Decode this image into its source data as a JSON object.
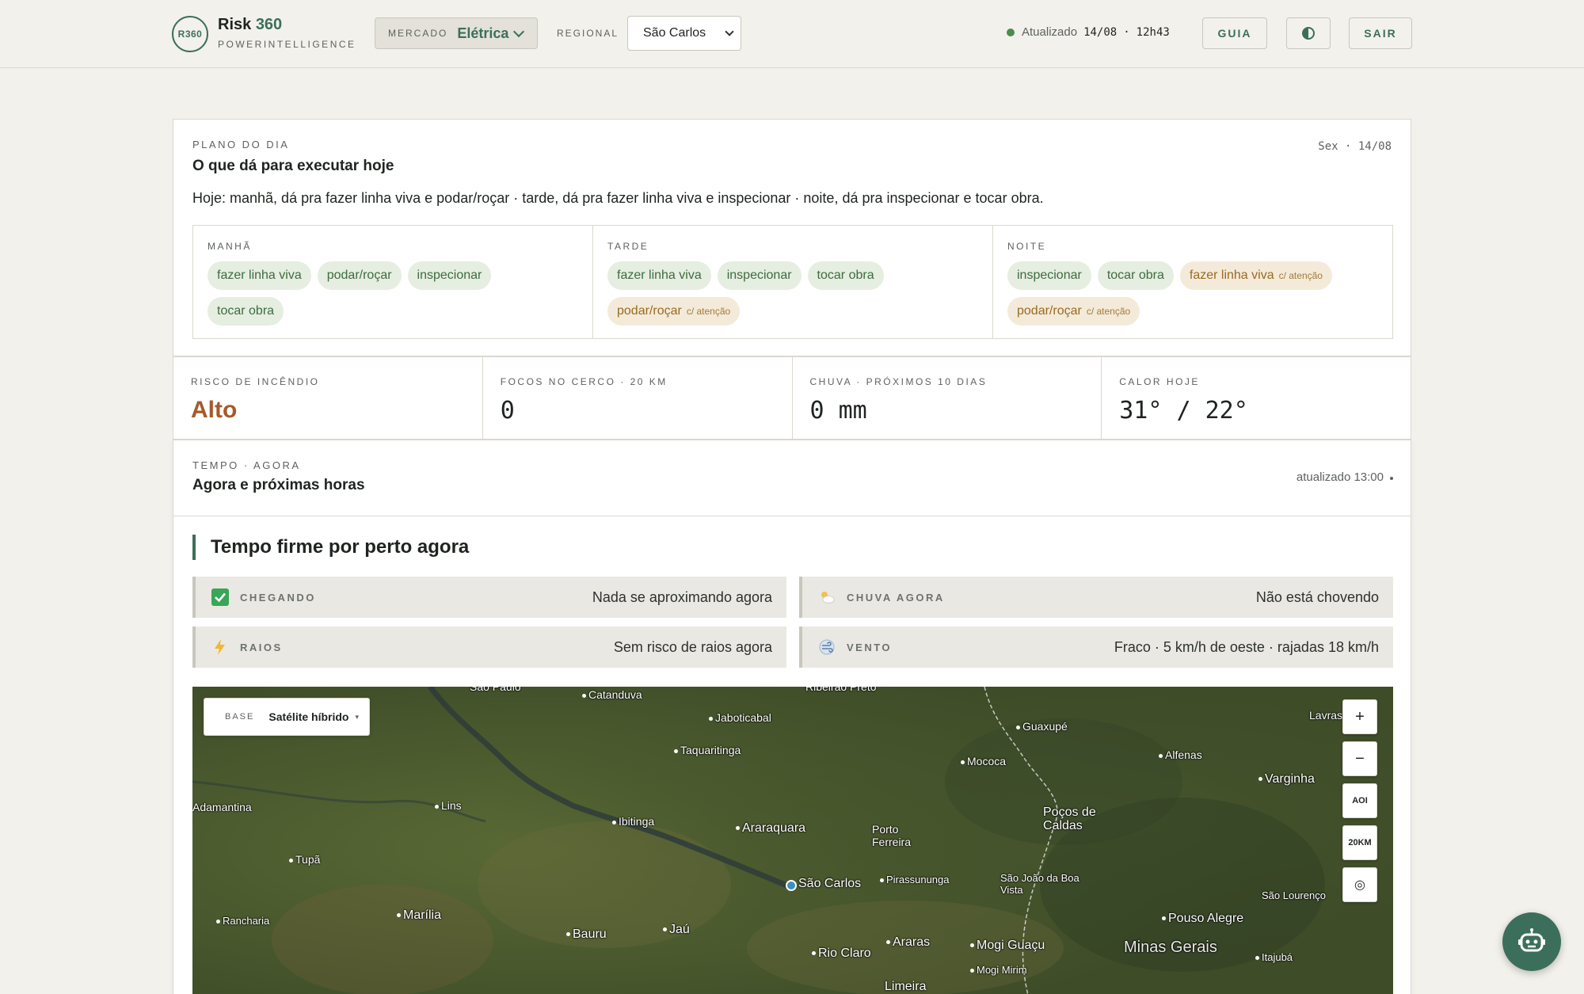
{
  "header": {
    "logo_badge": "R360",
    "brand_name": "Risk",
    "brand_num": "360",
    "brand_sub": "POWERINTELLIGENCE",
    "mercado_label": "MERCADO",
    "mercado_value": "Elétrica",
    "regional_label": "REGIONAL",
    "regional_value": "São Carlos",
    "updated_label": "Atualizado",
    "updated_date": "14/08",
    "updated_sep": "·",
    "updated_time": "12h43",
    "guide_label": "GUIA",
    "logout_label": "SAIR",
    "status_color": "#4a8c4f",
    "accent_color": "#3c6f5b"
  },
  "plan": {
    "eyebrow": "PLANO DO DIA",
    "title": "O que dá para executar hoje",
    "date": "Sex  ·  14/08",
    "summary": "Hoje: manhã, dá pra fazer linha viva e podar/roçar · tarde, dá pra fazer linha viva e inspecionar · noite, dá pra inspecionar e tocar obra.",
    "periods": [
      {
        "label": "MANHÃ",
        "chips": [
          {
            "text": "fazer linha viva",
            "status": "ok"
          },
          {
            "text": "podar/roçar",
            "status": "ok"
          },
          {
            "text": "inspecionar",
            "status": "ok"
          },
          {
            "text": "tocar obra",
            "status": "ok"
          }
        ]
      },
      {
        "label": "TARDE",
        "chips": [
          {
            "text": "fazer linha viva",
            "status": "ok"
          },
          {
            "text": "inspecionar",
            "status": "ok"
          },
          {
            "text": "tocar obra",
            "status": "ok"
          },
          {
            "text": "podar/roçar",
            "status": "warn",
            "note": "c/ atenção"
          }
        ]
      },
      {
        "label": "NOITE",
        "chips": [
          {
            "text": "inspecionar",
            "status": "ok"
          },
          {
            "text": "tocar obra",
            "status": "ok"
          },
          {
            "text": "fazer linha viva",
            "status": "warn",
            "note": "c/ atenção"
          },
          {
            "text": "podar/roçar",
            "status": "warn",
            "note": "c/ atenção"
          }
        ]
      }
    ]
  },
  "stats": [
    {
      "label": "RISCO DE INCÊNDIO",
      "value": "Alto"
    },
    {
      "label": "FOCOS NO CERCO · 20 KM",
      "value": "0"
    },
    {
      "label": "CHUVA · PRÓXIMOS 10 DIAS",
      "value": "0 mm"
    },
    {
      "label": "CALOR HOJE",
      "value": "31° / 22°"
    }
  ],
  "tempo": {
    "eyebrow": "TEMPO · AGORA",
    "title": "Agora e próximas horas",
    "updated": "atualizado 13:00",
    "headline": "Tempo firme por perto agora",
    "conditions": [
      {
        "icon": "check-icon",
        "label": "CHEGANDO",
        "value": "Nada se aproximando agora"
      },
      {
        "icon": "cloud-sun-icon",
        "label": "CHUVA AGORA",
        "value": "Não está chovendo"
      },
      {
        "icon": "lightning-icon",
        "label": "RAIOS",
        "value": "Sem risco de raios agora"
      },
      {
        "icon": "wind-icon",
        "label": "VENTO",
        "value": "Fraco · 5 km/h de oeste · rajadas 18 km/h"
      }
    ]
  },
  "map": {
    "base_label": "BASE",
    "base_value": "Satélite híbrido",
    "base_caret": "▾",
    "zoom_in": "+",
    "zoom_out": "−",
    "aoi": "AOI",
    "radius": "20KM",
    "locate": "◎",
    "cities": [
      "São Paulo",
      "Catanduva",
      "Ribeirão Preto",
      "Jaboticabal",
      "Guaxupé",
      "Lavras",
      "Taquaritinga",
      "Mococa",
      "Alfenas",
      "Varginha",
      "Adamantina",
      "Lins",
      "Ibitinga",
      "Araraquara",
      "Porto Ferreira",
      "Poços de Caldas",
      "Tupã",
      "São Carlos",
      "Pirassununga",
      "São João da Boa Vista",
      "São Lourenço",
      "Ranchariа",
      "Marília",
      "Bauru",
      "Jaú",
      "Rio Claro",
      "Araras",
      "Mogi Guaçu",
      "Pouso Alegre",
      "Minas Gerais",
      "Itajubá",
      "Mogi Mirim",
      "Limeira"
    ]
  },
  "assistant": {
    "icon": "robot-icon"
  }
}
